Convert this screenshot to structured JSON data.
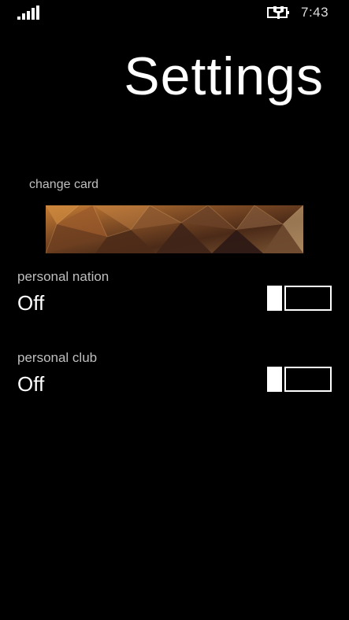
{
  "status_bar": {
    "signal_icon": "signal-strength-icon",
    "battery_icon": "battery-charging-icon",
    "time": "7:43"
  },
  "page": {
    "title": "Settings"
  },
  "card": {
    "label": "change card"
  },
  "settings": [
    {
      "label": "personal nation",
      "value": "Off",
      "enabled": false
    },
    {
      "label": "personal club",
      "value": "Off",
      "enabled": false
    }
  ],
  "colors": {
    "background": "#000000",
    "foreground": "#ffffff",
    "secondary_text": "#bfbfbf"
  }
}
